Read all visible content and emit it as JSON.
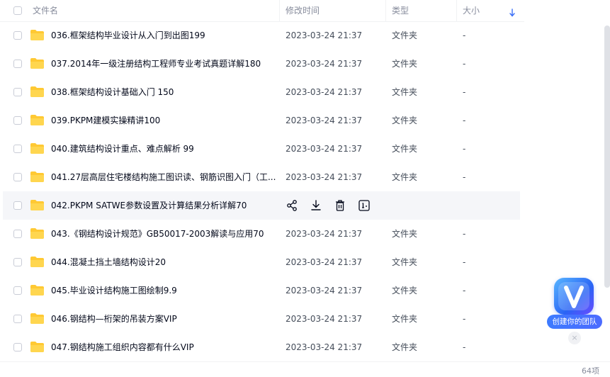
{
  "header": {
    "name": "文件名",
    "mtime": "修改时间",
    "type": "类型",
    "size": "大小"
  },
  "files": [
    {
      "name": "036.框架结构毕业设计从入门到出图199",
      "time": "2023-03-24 21:37",
      "type": "文件夹",
      "size": "-"
    },
    {
      "name": "037.2014年一级注册结构工程师专业考试真题详解180",
      "time": "2023-03-24 21:37",
      "type": "文件夹",
      "size": "-"
    },
    {
      "name": "038.框架结构设计基础入门 150",
      "time": "2023-03-24 21:37",
      "type": "文件夹",
      "size": "-"
    },
    {
      "name": "039.PKPM建模实操精讲100",
      "time": "2023-03-24 21:37",
      "type": "文件夹",
      "size": "-"
    },
    {
      "name": "040.建筑结构设计重点、难点解析 99",
      "time": "2023-03-24 21:37",
      "type": "文件夹",
      "size": "-"
    },
    {
      "name": "041.27层高层住宅楼结构施工图识读、钢筋识图入门（工...",
      "time": "2023-03-24 21:37",
      "type": "文件夹",
      "size": "-"
    },
    {
      "name": "042.PKPM SATWE参数设置及计算结果分析详解70",
      "time": "",
      "type": "",
      "size": ""
    },
    {
      "name": "043.《钢结构设计规范》GB50017-2003解读与应用70",
      "time": "2023-03-24 21:37",
      "type": "文件夹",
      "size": "-"
    },
    {
      "name": "044.混凝土挡土墙结构设计20",
      "time": "2023-03-24 21:37",
      "type": "文件夹",
      "size": "-"
    },
    {
      "name": "045.毕业设计结构施工图绘制9.9",
      "time": "2023-03-24 21:37",
      "type": "文件夹",
      "size": "-"
    },
    {
      "name": "046.钢结构—桁架的吊装方案VIP",
      "time": "2023-03-24 21:37",
      "type": "文件夹",
      "size": "-"
    },
    {
      "name": "047.钢结构施工组织内容都有什么VIP",
      "time": "2023-03-24 21:37",
      "type": "文件夹",
      "size": "-"
    }
  ],
  "hover_actions": [
    "share-icon",
    "download-icon",
    "delete-icon",
    "rename-icon"
  ],
  "badge": {
    "text": "创建你的团队",
    "close": "×"
  },
  "footer": {
    "count": "64项"
  },
  "colors": {
    "folder": "#ffc933",
    "accent": "#3a6ff7"
  }
}
